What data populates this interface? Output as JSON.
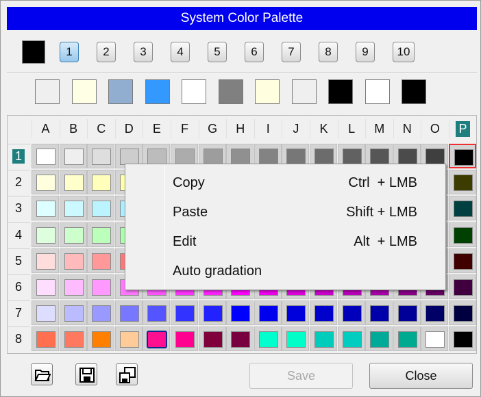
{
  "window": {
    "title": "System Color Palette"
  },
  "current_color": "#000000",
  "pages": [
    {
      "label": "1",
      "active": true
    },
    {
      "label": "2",
      "active": false
    },
    {
      "label": "3",
      "active": false
    },
    {
      "label": "4",
      "active": false
    },
    {
      "label": "5",
      "active": false
    },
    {
      "label": "6",
      "active": false
    },
    {
      "label": "7",
      "active": false
    },
    {
      "label": "8",
      "active": false
    },
    {
      "label": "9",
      "active": false
    },
    {
      "label": "10",
      "active": false
    }
  ],
  "recent_colors": [
    "#efefef",
    "#ffffe6",
    "#91aed0",
    "#3399ff",
    "#ffffff",
    "#808080",
    "#ffffe0",
    "#efefef",
    "#000000",
    "#ffffff",
    "#000000"
  ],
  "grid": {
    "columns": [
      "A",
      "B",
      "C",
      "D",
      "E",
      "F",
      "G",
      "H",
      "I",
      "J",
      "K",
      "L",
      "M",
      "N",
      "O",
      "P"
    ],
    "rows": [
      "1",
      "2",
      "3",
      "4",
      "5",
      "6",
      "7",
      "8"
    ],
    "selected_column": "P",
    "selected_row": "1",
    "colors": [
      [
        "#ffffff",
        "#efefef",
        "#dedede",
        "#cdcdcd",
        "#bcbcbc",
        "#acacac",
        "#9d9d9d",
        "#909090",
        "#838383",
        "#777777",
        "#6c6c6c",
        "#616161",
        "#565656",
        "#4b4b4b",
        "#3f3f3f",
        "#000000"
      ],
      [
        "#ffffdd",
        "#ffffcc",
        "#ffffbb",
        "#ffffaa",
        "#eeeea0",
        "#dddd90",
        "#cccc80",
        "#bbbb70",
        "#aaaa60",
        "#999950",
        "#888840",
        "#777730",
        "#666620",
        "#555510",
        "#444408",
        "#3c3c00"
      ],
      [
        "#ddffff",
        "#ccf8ff",
        "#bbf4ff",
        "#aaeeff",
        "#90e0f0",
        "#80d0e0",
        "#70c0d0",
        "#60b0c0",
        "#50a0b0",
        "#409090",
        "#308080",
        "#207070",
        "#106060",
        "#085050",
        "#004848",
        "#004040"
      ],
      [
        "#ddffdd",
        "#ccffcc",
        "#bbffbb",
        "#aaffaa",
        "#90ee90",
        "#80dd80",
        "#70cc70",
        "#60bb60",
        "#50aa50",
        "#409940",
        "#308830",
        "#207720",
        "#106610",
        "#085508",
        "#004800",
        "#004000"
      ],
      [
        "#ffdddd",
        "#ffbbbb",
        "#ff9999",
        "#ff7777",
        "#ee6666",
        "#dd5555",
        "#cc4444",
        "#bb3333",
        "#aa2222",
        "#991111",
        "#880808",
        "#770000",
        "#660000",
        "#550000",
        "#480000",
        "#400000"
      ],
      [
        "#ffddff",
        "#ffbbff",
        "#ff99ff",
        "#ff77ff",
        "#ff55ff",
        "#ff33ff",
        "#ff22ff",
        "#ff00ff",
        "#ee00ee",
        "#dd00dd",
        "#cc00cc",
        "#bb00bb",
        "#aa00aa",
        "#880088",
        "#660066",
        "#400040"
      ],
      [
        "#ddddff",
        "#bbbbff",
        "#9999ff",
        "#7777ff",
        "#5555ff",
        "#3333ff",
        "#2222ff",
        "#0000ff",
        "#0000ee",
        "#0000dd",
        "#0000cc",
        "#0000bb",
        "#0000aa",
        "#000099",
        "#000066",
        "#000040"
      ],
      [
        "#ff7050",
        "#ff7860",
        "#ff8000",
        "#ffcc99",
        "#ff1090",
        "#ff0090",
        "#80003c",
        "#780040",
        "#00ffcc",
        "#00ffc8",
        "#00ccbb",
        "#00ccc0",
        "#00aa99",
        "#00aa90",
        "#ffffff",
        "#000000"
      ]
    ]
  },
  "context_menu": {
    "items": [
      {
        "label": "Copy",
        "shortcut": "Ctrl  + LMB"
      },
      {
        "label": "Paste",
        "shortcut": "Shift + LMB"
      },
      {
        "label": "Edit",
        "shortcut": "Alt  + LMB"
      },
      {
        "label": "Auto gradation",
        "shortcut": ""
      }
    ]
  },
  "footer": {
    "tools": [
      {
        "icon": "open-folder-icon"
      },
      {
        "icon": "save-disk-icon"
      },
      {
        "icon": "save-as-disks-icon"
      }
    ],
    "save_label": "Save",
    "close_label": "Close"
  }
}
